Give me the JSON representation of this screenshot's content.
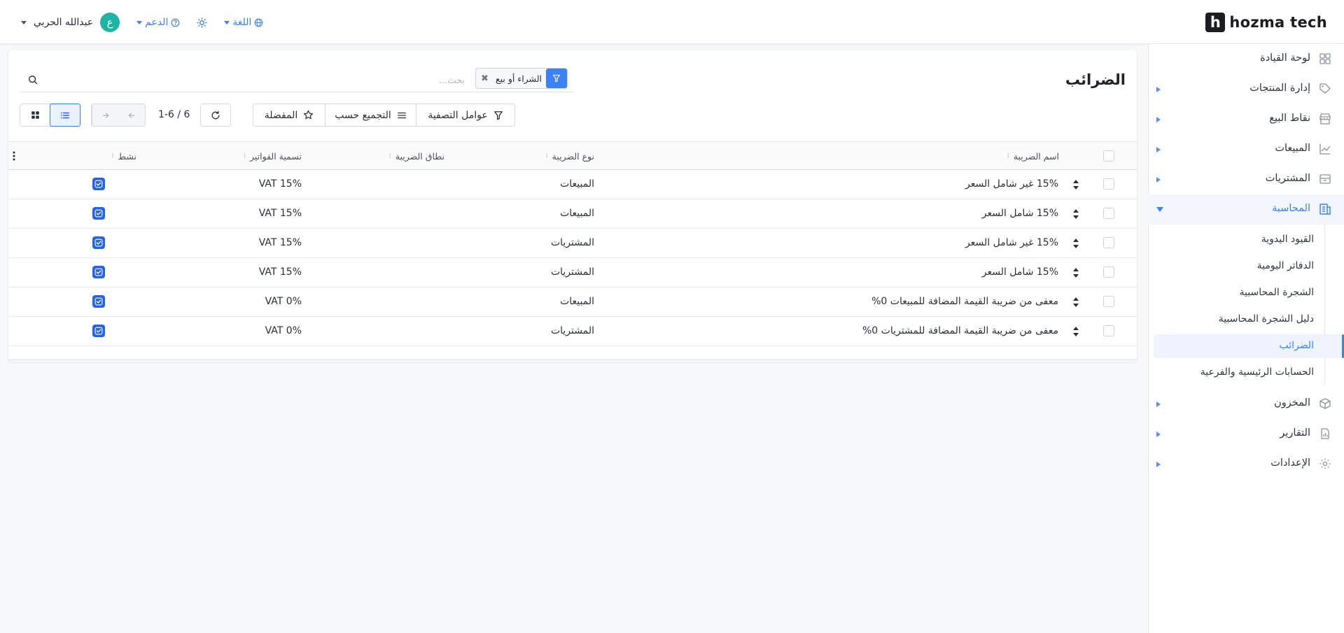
{
  "brand": {
    "name": "hozma tech",
    "mark": "h"
  },
  "header": {
    "user_name": "عبدالله الحربي",
    "avatar_letter": "ع",
    "support_label": "الدعم",
    "language_label": "اللغة"
  },
  "sidebar": {
    "items": [
      {
        "label": "لوحة القيادة",
        "icon": "dashboard-icon",
        "has_caret": false
      },
      {
        "label": "إدارة المنتجات",
        "icon": "tag-icon",
        "has_caret": true
      },
      {
        "label": "نقاط البيع",
        "icon": "store-icon",
        "has_caret": true
      },
      {
        "label": "المبيعات",
        "icon": "chart-line-icon",
        "has_caret": true
      },
      {
        "label": "المشتريات",
        "icon": "inbox-icon",
        "has_caret": true
      },
      {
        "label": "المحاسبة",
        "icon": "accounting-icon",
        "has_caret": true,
        "active": true
      },
      {
        "label": "المخزون",
        "icon": "box-icon",
        "has_caret": true
      },
      {
        "label": "التقارير",
        "icon": "report-icon",
        "has_caret": true
      },
      {
        "label": "الإعدادات",
        "icon": "gear-icon",
        "has_caret": true
      }
    ],
    "accounting_sub": [
      "القيود اليدوية",
      "الدفاتر اليومية",
      "الشجرة المحاسبية",
      "دليل الشجرة المحاسبية",
      "الضرائب",
      "الحسابات الرئيسية والفرعية"
    ],
    "active_sub": "الضرائب"
  },
  "page": {
    "title": "الضرائب",
    "search_placeholder": "بحث...",
    "filter_chip": "الشراء أو بيع",
    "toolbar": {
      "filters": "عوامل التصفية",
      "group_by": "التجميع حسب",
      "favorites": "المفضلة"
    },
    "pager": "1-6 / 6"
  },
  "table": {
    "columns": {
      "name": "اسم الضريبة",
      "type": "نوع الضريبة",
      "scope": "نطاق الضريبة",
      "label": "تسمية الفواتير",
      "active": "نشط"
    },
    "rows": [
      {
        "name": "15% غير شامل السعر",
        "type": "المبيعات",
        "label": "VAT 15%",
        "active": true
      },
      {
        "name": "15% شامل السعر",
        "type": "المبيعات",
        "label": "VAT 15%",
        "active": true
      },
      {
        "name": "15% غير شامل السعر",
        "type": "المشتريات",
        "label": "VAT 15%",
        "active": true
      },
      {
        "name": "15% شامل السعر",
        "type": "المشتريات",
        "label": "VAT 15%",
        "active": true
      },
      {
        "name": "معفى من ضريبة القيمة المضافة للمبيعات 0%",
        "type": "المبيعات",
        "label": "VAT 0%",
        "active": true
      },
      {
        "name": "معفى من ضريبة القيمة المضافة للمشتريات 0%",
        "type": "المشتريات",
        "label": "VAT 0%",
        "active": true
      }
    ]
  },
  "colors": {
    "accent": "#3b82f6",
    "avatar": "#1fb3a3",
    "brand": "#1b1d21"
  }
}
